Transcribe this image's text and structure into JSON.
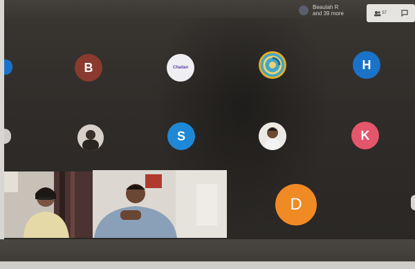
{
  "header": {
    "participants_line1": "Beaulah R",
    "participants_line2": "and 39 more",
    "people_count": "57"
  },
  "icons": {
    "people": "people-icon",
    "chat": "chat-icon"
  },
  "avatars": [
    {
      "letter": "B",
      "color": "#8a3a2e"
    },
    {
      "letter": "H",
      "color": "#1a73c8"
    },
    {
      "letter": "S",
      "color": "#1e88d6"
    },
    {
      "letter": "K",
      "color": "#e4566b"
    },
    {
      "letter": "D",
      "color": "#f08a24"
    }
  ],
  "logo_avatar_text": "Chaitan"
}
